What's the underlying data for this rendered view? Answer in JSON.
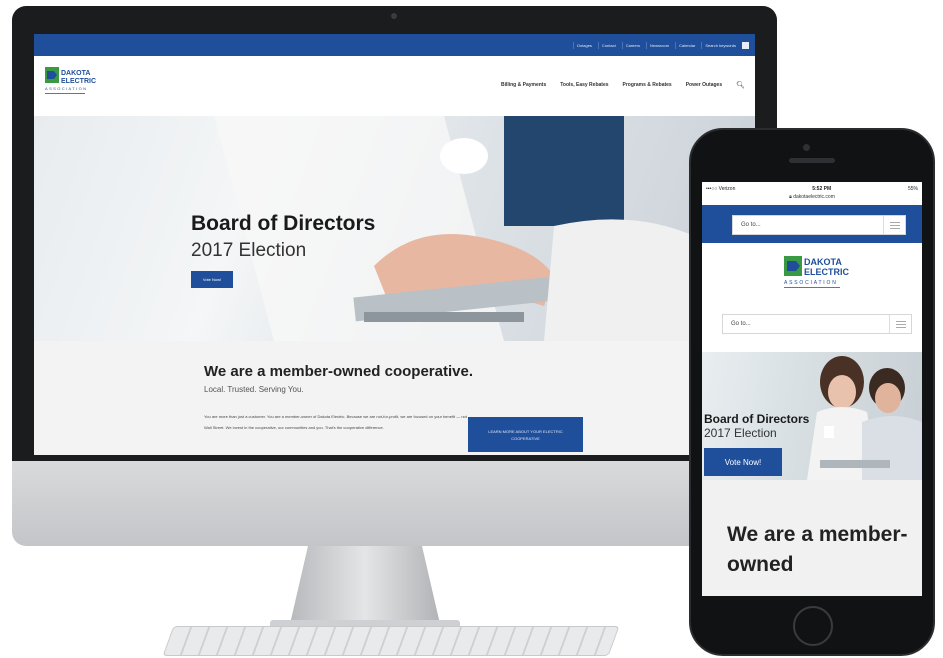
{
  "desktop": {
    "top_links": [
      "Outages",
      "Contact",
      "Careers",
      "Newsroom",
      "Calendar",
      "Search keywords"
    ],
    "nav": [
      "Billing & Payments",
      "Tools, Easy Rebates",
      "Programs & Rebates",
      "Power Outages"
    ],
    "hero": {
      "title": "Board of Directors",
      "subtitle": "2017 Election",
      "button": "Vote Now!"
    },
    "intro": {
      "title": "We are a member-owned cooperative.",
      "subtitle": "Local. Trusted. Serving You.",
      "body": "You are more than just a customer. You are a member-owner of Dakota Electric. Because we are not-for-profit, we are focused on your benefit — not Wall Street. We invest in the cooperative, our communities and you. That's the cooperative difference.",
      "button": "LEARN MORE ABOUT YOUR ELECTRIC COOPERATIVE"
    }
  },
  "mobile": {
    "status": {
      "carrier": "•••○○ Verizon",
      "time": "5:52 PM",
      "battery": "55%"
    },
    "url": "dakotaelectric.com",
    "select_label": "Go to...",
    "hero": {
      "title": "Board of Directors",
      "subtitle": "2017 Election",
      "button": "Vote Now!"
    },
    "intro_title": "We are a member-owned"
  },
  "logo": {
    "line1": "DAKOTA",
    "line2": "ELECTRIC",
    "line3": "ASSOCIATION"
  },
  "colors": {
    "brand_blue": "#1f4e9b",
    "logo_green": "#3a9a44"
  }
}
